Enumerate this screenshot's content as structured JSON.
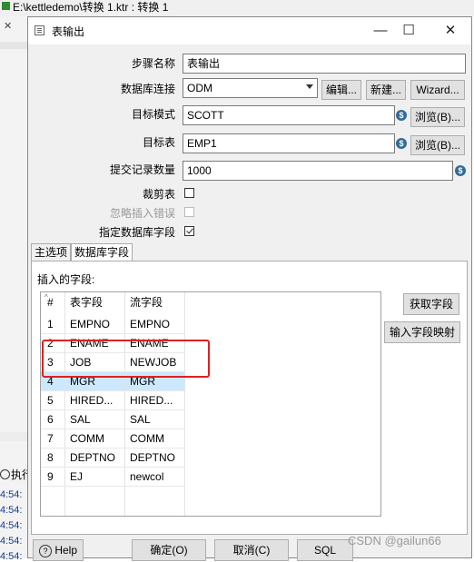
{
  "background": {
    "window_title": "E:\\kettledemo\\转换 1.ktr : 转换 1",
    "left_tab_close": "✕",
    "exec_label": "执行",
    "log_lines": [
      "4:54:",
      "4:54:",
      "4:54:",
      "4:54:",
      "4:54:"
    ]
  },
  "dialog": {
    "title": "表输出",
    "window_controls": {
      "minimize": "—",
      "maximize": "☐",
      "close": "✕"
    },
    "fields": {
      "step_name": {
        "label": "步骤名称",
        "value": "表输出"
      },
      "connection": {
        "label": "数据库连接",
        "value": "ODM",
        "edit": "编辑...",
        "new": "新建...",
        "wizard": "Wizard..."
      },
      "target_schema": {
        "label": "目标模式",
        "value": "SCOTT",
        "browse": "浏览(B)..."
      },
      "target_table": {
        "label": "目标表",
        "value": "EMP1",
        "browse": "浏览(B)..."
      },
      "commit_size": {
        "label": "提交记录数量",
        "value": "1000"
      },
      "truncate": {
        "label": "裁剪表",
        "checked": false
      },
      "ignore_errors": {
        "label": "忽略插入错误",
        "checked": false,
        "disabled": true
      },
      "specify_fields": {
        "label": "指定数据库字段",
        "checked": true
      }
    },
    "tabs": [
      {
        "label": "主选项",
        "active": false
      },
      {
        "label": "数据库字段",
        "active": true
      }
    ],
    "fields_tab": {
      "section_label": "插入的字段:",
      "columns": [
        "#",
        "表字段",
        "流字段"
      ],
      "rows": [
        {
          "n": "1",
          "table_field": "EMPNO",
          "stream_field": "EMPNO"
        },
        {
          "n": "2",
          "table_field": "ENAME",
          "stream_field": "ENAME"
        },
        {
          "n": "3",
          "table_field": "JOB",
          "stream_field": "NEWJOB"
        },
        {
          "n": "4",
          "table_field": "MGR",
          "stream_field": "MGR"
        },
        {
          "n": "5",
          "table_field": "HIRED...",
          "stream_field": "HIRED..."
        },
        {
          "n": "6",
          "table_field": "SAL",
          "stream_field": "SAL"
        },
        {
          "n": "7",
          "table_field": "COMM",
          "stream_field": "COMM"
        },
        {
          "n": "8",
          "table_field": "DEPTNO",
          "stream_field": "DEPTNO"
        },
        {
          "n": "9",
          "table_field": "EJ",
          "stream_field": "newcol"
        }
      ],
      "selected_row": 3,
      "get_fields_button": "获取字段",
      "map_fields_button": "输入字段映射"
    },
    "footer": {
      "help": "Help",
      "ok": "确定(O)",
      "cancel": "取消(C)",
      "sql": "SQL"
    },
    "variable_icon": "$"
  },
  "watermark": "CSDN @gailun66",
  "colors": {
    "highlight_box": "#e02020",
    "selected_row": "#cce8ff",
    "variable_icon": "#2f6c9a"
  }
}
